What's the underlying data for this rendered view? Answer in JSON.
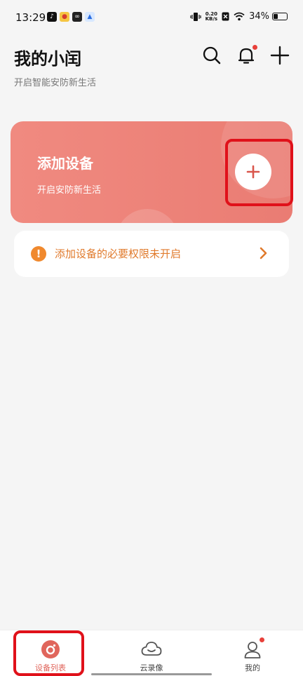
{
  "status_bar": {
    "time": "13:29",
    "speed_value": "0.20",
    "speed_unit": "KB/s",
    "battery": "34%",
    "battery_level": 0.34
  },
  "header": {
    "title": "我的小闰",
    "subtitle": "开启智能安防新生活"
  },
  "banner": {
    "title": "添加设备",
    "subtitle": "开启安防新生活"
  },
  "permission_notice": {
    "icon_text": "!",
    "text": "添加设备的必要权限未开启"
  },
  "bottom_nav": {
    "items": [
      {
        "label": "设备列表",
        "icon": "device-list-icon",
        "active": true
      },
      {
        "label": "云录像",
        "icon": "cloud-icon",
        "active": false
      },
      {
        "label": "我的",
        "icon": "profile-icon",
        "active": false
      }
    ]
  },
  "colors": {
    "accent": "#e0665c",
    "banner": "#ec7f76",
    "warning": "#f0892e",
    "highlight_box": "#e0111a"
  }
}
